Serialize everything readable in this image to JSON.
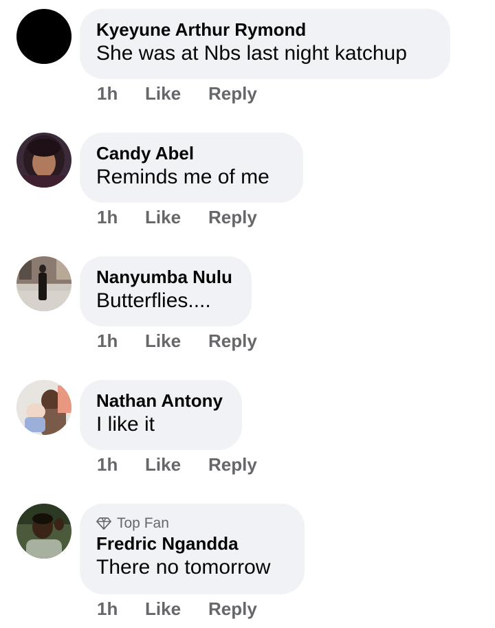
{
  "comments": [
    {
      "author": "Kyeyune Arthur Rymond",
      "text": "She was at Nbs last night katchup",
      "time": "1h",
      "like_label": "Like",
      "reply_label": "Reply",
      "avatar": "black-circle-avatar"
    },
    {
      "author": "Candy Abel",
      "text": "Reminds me of me",
      "time": "1h",
      "like_label": "Like",
      "reply_label": "Reply",
      "avatar": "woman-portrait-avatar"
    },
    {
      "author": "Nanyumba Nulu",
      "text": "Butterflies....",
      "time": "1h",
      "like_label": "Like",
      "reply_label": "Reply",
      "avatar": "standing-person-avatar"
    },
    {
      "author": "Nathan Antony",
      "text": "I like it",
      "time": "1h",
      "like_label": "Like",
      "reply_label": "Reply",
      "avatar": "man-with-baby-avatar"
    },
    {
      "badge": "Top Fan",
      "badge_icon": "diamond-icon",
      "author": "Fredric Ngandda",
      "text": "There no tomorrow",
      "time": "1h",
      "like_label": "Like",
      "reply_label": "Reply",
      "avatar": "young-man-avatar"
    }
  ],
  "colors": {
    "bubble_background": "#f0f2f5",
    "primary_text": "#050505",
    "secondary_text": "#65676b"
  }
}
